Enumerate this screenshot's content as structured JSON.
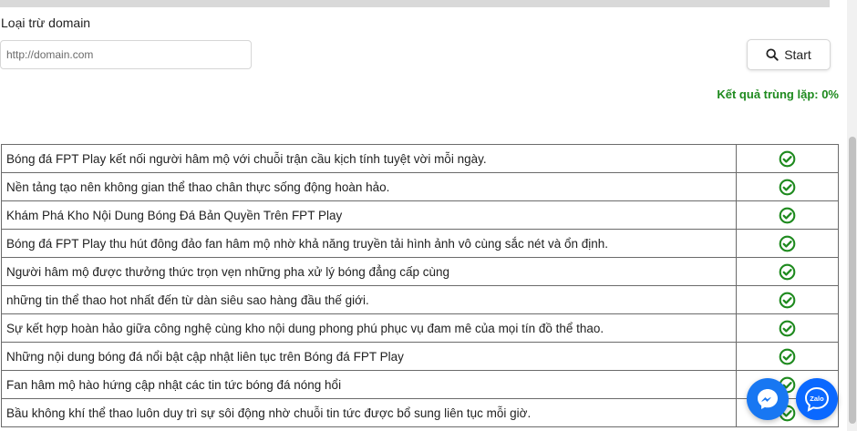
{
  "exclude": {
    "label": "Loại trừ domain",
    "placeholder": "http://domain.com",
    "value": ""
  },
  "start_button": {
    "label": "Start",
    "icon": "search-icon"
  },
  "result": {
    "text": "Kết quả trùng lặp: 0%"
  },
  "rows": [
    {
      "text": "Bóng đá FPT Play kết nối người hâm mộ với chuỗi trận cầu kịch tính tuyệt vời mỗi ngày.",
      "status": "check-circle-icon"
    },
    {
      "text": "Nền tảng tạo nên không gian thể thao chân thực sống động hoàn hảo.",
      "status": "check-circle-icon"
    },
    {
      "text": "Khám Phá Kho Nội Dung Bóng Đá Bản Quyền Trên FPT Play",
      "status": "check-circle-icon"
    },
    {
      "text": "Bóng đá FPT Play thu hút đông đảo fan hâm mộ nhờ khả năng truyền tải hình ảnh vô cùng sắc nét và ổn định.",
      "status": "check-circle-icon"
    },
    {
      "text": "Người hâm mộ được thưởng thức trọn vẹn những pha xử lý bóng đẳng cấp cùng",
      "status": "check-circle-icon"
    },
    {
      "text": "những tin thể thao hot nhất đến từ dàn siêu sao hàng đầu thế giới.",
      "status": "check-circle-icon"
    },
    {
      "text": "Sự kết hợp hoàn hảo giữa công nghệ cùng kho nội dung phong phú phục vụ đam mê của mọi tín đồ thể thao.",
      "status": "check-circle-icon"
    },
    {
      "text": "Những nội dung bóng đá nổi bật cập nhật liên tục trên Bóng đá FPT Play",
      "status": "check-circle-icon"
    },
    {
      "text": "Fan hâm mộ hào hứng cập nhật các tin tức bóng đá nóng hổi",
      "status": "check-circle-icon"
    },
    {
      "text": "Bầu không khí thể thao luôn duy trì sự sôi động nhờ chuỗi tin tức được bổ sung liên tục mỗi giờ.",
      "status": "check-circle-icon"
    }
  ],
  "floating": {
    "messenger_icon": "messenger-icon",
    "zalo_label": "Zalo"
  },
  "colors": {
    "success": "#1e8a1e",
    "fab_blue": "#1877f2"
  }
}
